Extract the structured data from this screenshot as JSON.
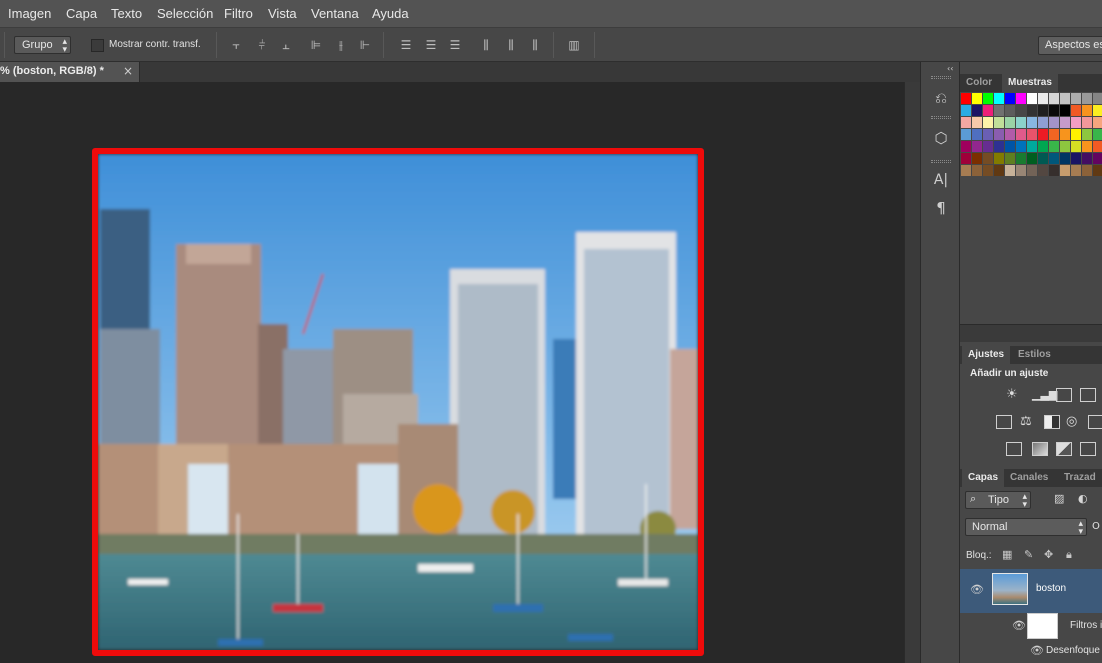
{
  "menu": [
    "Imagen",
    "Capa",
    "Texto",
    "Selección",
    "Filtro",
    "Vista",
    "Ventana",
    "Ayuda"
  ],
  "options": {
    "group_select": "Grupo",
    "show_transform_label": "Mostrar contr. transf.",
    "workspace_button": "Aspectos ese"
  },
  "document": {
    "tab_title": "% (boston, RGB/8) *",
    "close_glyph": "×"
  },
  "dock": {
    "collapse_glyph": "‹‹",
    "icons": [
      "history-icon",
      "3d-cube-icon",
      "character-icon",
      "paragraph-icon"
    ],
    "character_glyph": "A|",
    "paragraph_glyph": "¶"
  },
  "swatches_panel": {
    "tabs": [
      "Color",
      "Muestras"
    ],
    "active_tab": "Muestras",
    "swatch_colors": [
      [
        "#ff0000",
        "#ffff00",
        "#00ff00",
        "#00ffff",
        "#0000ff",
        "#ff00ff",
        "#ffffff",
        "#ebebeb",
        "#d6d6d6",
        "#c2c2c2",
        "#adadad",
        "#999999",
        "#858585"
      ],
      [
        "#29abe2",
        "#1b1464",
        "#ed1e79",
        "#707070",
        "#5c5c5c",
        "#474747",
        "#333333",
        "#1f1f1f",
        "#0a0a0a",
        "#000000",
        "#f15a24",
        "#f7931e",
        "#fcee21"
      ],
      [
        "#f2a7a2",
        "#f7c9a9",
        "#fcf2a9",
        "#c1df99",
        "#9ad3a6",
        "#8bd2cb",
        "#88b7e2",
        "#8f9fd3",
        "#a393c8",
        "#c69bc9",
        "#f29ec3",
        "#f2979b",
        "#f7a57e"
      ],
      [
        "#5b9bd5",
        "#4f6fc0",
        "#6a5fb4",
        "#8a5db0",
        "#b25ba9",
        "#e05a8b",
        "#e8536b",
        "#ed1c24",
        "#f26522",
        "#f7941d",
        "#fff200",
        "#8dc63f",
        "#39b54a"
      ],
      [
        "#9e005d",
        "#92278f",
        "#662d91",
        "#2e3192",
        "#0054a6",
        "#0072bc",
        "#00a99d",
        "#00a651",
        "#39b54a",
        "#8dc63f",
        "#d7df23",
        "#f7941d",
        "#f15a24"
      ],
      [
        "#9e0039",
        "#7b2e00",
        "#754c24",
        "#827b00",
        "#5e7f21",
        "#197b30",
        "#005e20",
        "#005952",
        "#00577b",
        "#003663",
        "#1b1464",
        "#440e62",
        "#630460"
      ],
      [
        "#a67c52",
        "#8c6239",
        "#754c24",
        "#603913",
        "#c7b299",
        "#998675",
        "#736357",
        "#534741",
        "#362f2d",
        "#c69c6d",
        "#a67c52",
        "#8c6239",
        "#603913"
      ]
    ]
  },
  "adjust_panel": {
    "tabs": [
      "Ajustes",
      "Estilos"
    ],
    "active_tab": "Ajustes",
    "heading": "Añadir un ajuste"
  },
  "layers_panel": {
    "tabs": [
      "Capas",
      "Canales",
      "Trazad"
    ],
    "active_tab": "Capas",
    "filter_label": "Tipo",
    "blend_mode": "Normal",
    "opacity_label": "O",
    "lock_label": "Bloq.:",
    "layers": [
      {
        "name": "boston",
        "selected": true
      },
      {
        "name": "Filtros i",
        "selected": false
      },
      {
        "name": "Desenfoque",
        "selected": false
      }
    ]
  }
}
